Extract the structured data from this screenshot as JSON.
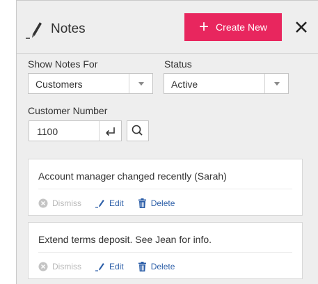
{
  "header": {
    "title": "Notes",
    "title_icon": "pen-icon",
    "create_button": {
      "icon": "plus",
      "label": "Create New"
    },
    "close_icon": "close-icon"
  },
  "filters": {
    "show_notes_for": {
      "label": "Show Notes For",
      "value": "Customers"
    },
    "status": {
      "label": "Status",
      "value": "Active"
    },
    "customer_number": {
      "label": "Customer Number",
      "value": "1100"
    }
  },
  "notes": [
    {
      "text": "Account manager changed recently (Sarah)",
      "dismiss": "Dismiss",
      "edit": "Edit",
      "delete": "Delete"
    },
    {
      "text": "Extend terms deposit. See Jean for info.",
      "dismiss": "Dismiss",
      "edit": "Edit",
      "delete": "Delete"
    }
  ],
  "colors": {
    "accent": "#e8265e",
    "link": "#2d5fa8",
    "panel_bg": "#eeeeee",
    "disabled": "#b8b8b8"
  }
}
